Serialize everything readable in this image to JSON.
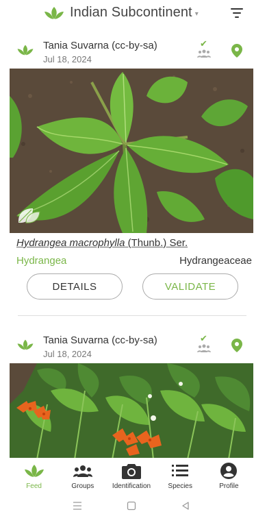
{
  "header": {
    "title": "Indian Subcontinent",
    "chevron": "▾"
  },
  "colors": {
    "brand_green": "#7ab648",
    "text": "#333333",
    "muted": "#777777"
  },
  "observations": [
    {
      "author": "Tania Suvarna (cc-by-sa)",
      "date": "Jul 18, 2024",
      "status_icon": "check-icon",
      "sci_name_italic": "Hydrangea macrophylla",
      "sci_name_author": " (Thunb.) Ser.",
      "common_name": "Hydrangea",
      "family": "Hydrangeaceae",
      "details_label": "DETAILS",
      "validate_label": "VALIDATE"
    },
    {
      "author": "Tania Suvarna (cc-by-sa)",
      "date": "Jul 18, 2024",
      "status_icon": "check-icon"
    }
  ],
  "nav": {
    "items": [
      {
        "label": "Feed",
        "icon": "leaf-icon"
      },
      {
        "label": "Groups",
        "icon": "groups-icon"
      },
      {
        "label": "Identification",
        "icon": "camera-icon"
      },
      {
        "label": "Species",
        "icon": "list-icon"
      },
      {
        "label": "Profile",
        "icon": "profile-icon"
      }
    ]
  },
  "system_bar": {
    "menu": "☰",
    "home": "▢",
    "back": "◁"
  }
}
